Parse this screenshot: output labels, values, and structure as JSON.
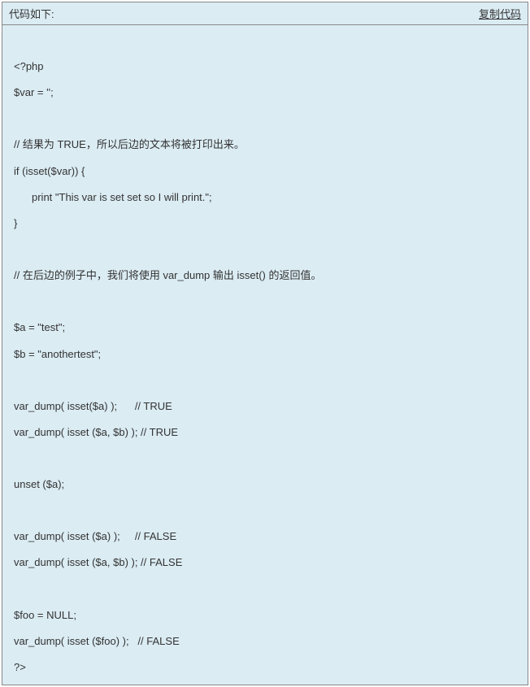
{
  "header": {
    "label": "代码如下:",
    "copy": "复制代码"
  },
  "code": {
    "lines": [
      "",
      "<?php",
      "$var = '';",
      "",
      "// 结果为 TRUE，所以后边的文本将被打印出来。",
      "if (isset($var)) {",
      "print \"This var is set set so I will print.\";",
      "}",
      "",
      "// 在后边的例子中，我们将使用 var_dump 输出 isset() 的返回值。",
      "",
      "$a = \"test\";",
      "$b = \"anothertest\";",
      "",
      "var_dump( isset($a) );      // TRUE",
      "var_dump( isset ($a, $b) ); // TRUE",
      "",
      "unset ($a);",
      "",
      "var_dump( isset ($a) );     // FALSE",
      "var_dump( isset ($a, $b) ); // FALSE",
      "",
      "$foo = NULL;",
      "var_dump( isset ($foo) );   // FALSE",
      "?>"
    ]
  }
}
